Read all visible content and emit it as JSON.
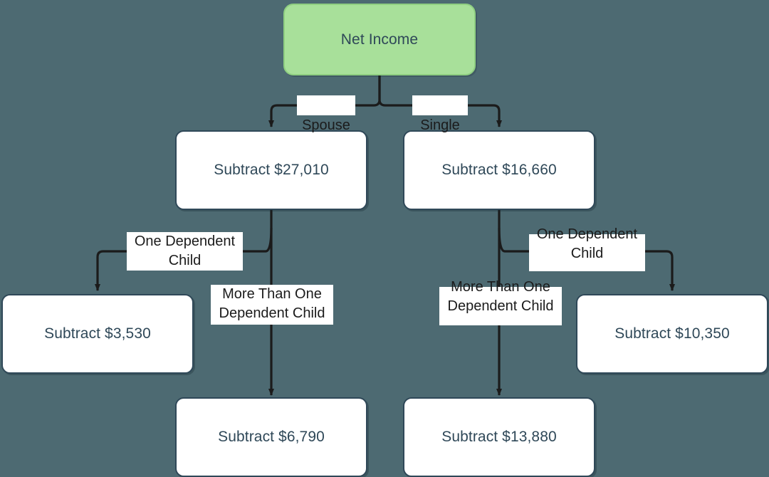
{
  "diagram": {
    "title": "Net Income tax deduction decision flowchart",
    "background_color": "#4d6a72",
    "node_fill": "#ffffff",
    "start_fill": "#a8e09a",
    "node_text_color": "#2f4858",
    "edge_color": "#1b1b1b",
    "nodes": [
      {
        "id": "net_income",
        "label": "Net Income",
        "type": "start"
      },
      {
        "id": "sub_27010",
        "label": "Subtract $27,010",
        "type": "process"
      },
      {
        "id": "sub_16660",
        "label": "Subtract $16,660",
        "type": "process"
      },
      {
        "id": "sub_3530",
        "label": "Subtract $3,530",
        "type": "process"
      },
      {
        "id": "sub_6790",
        "label": "Subtract $6,790",
        "type": "process"
      },
      {
        "id": "sub_10350",
        "label": "Subtract $10,350",
        "type": "process"
      },
      {
        "id": "sub_13880",
        "label": "Subtract $13,880",
        "type": "process"
      }
    ],
    "edge_labels": [
      {
        "id": "spouse",
        "text": "Spouse"
      },
      {
        "id": "single",
        "text": "Single"
      },
      {
        "id": "one_dep_left",
        "text": "One Dependent\nChild"
      },
      {
        "id": "more_dep_left",
        "text": "More Than One\nDependent Child"
      },
      {
        "id": "one_dep_right",
        "text": "One Dependent\nChild"
      },
      {
        "id": "more_dep_right",
        "text": "More Than One\nDependent Child"
      }
    ],
    "edges": [
      {
        "from": "net_income",
        "to": "sub_27010",
        "label": "Spouse"
      },
      {
        "from": "net_income",
        "to": "sub_16660",
        "label": "Single"
      },
      {
        "from": "sub_27010",
        "to": "sub_3530",
        "label": "One Dependent Child"
      },
      {
        "from": "sub_27010",
        "to": "sub_6790",
        "label": "More Than One Dependent Child"
      },
      {
        "from": "sub_16660",
        "to": "sub_10350",
        "label": "One Dependent Child"
      },
      {
        "from": "sub_16660",
        "to": "sub_13880",
        "label": "More Than One Dependent Child"
      }
    ]
  }
}
